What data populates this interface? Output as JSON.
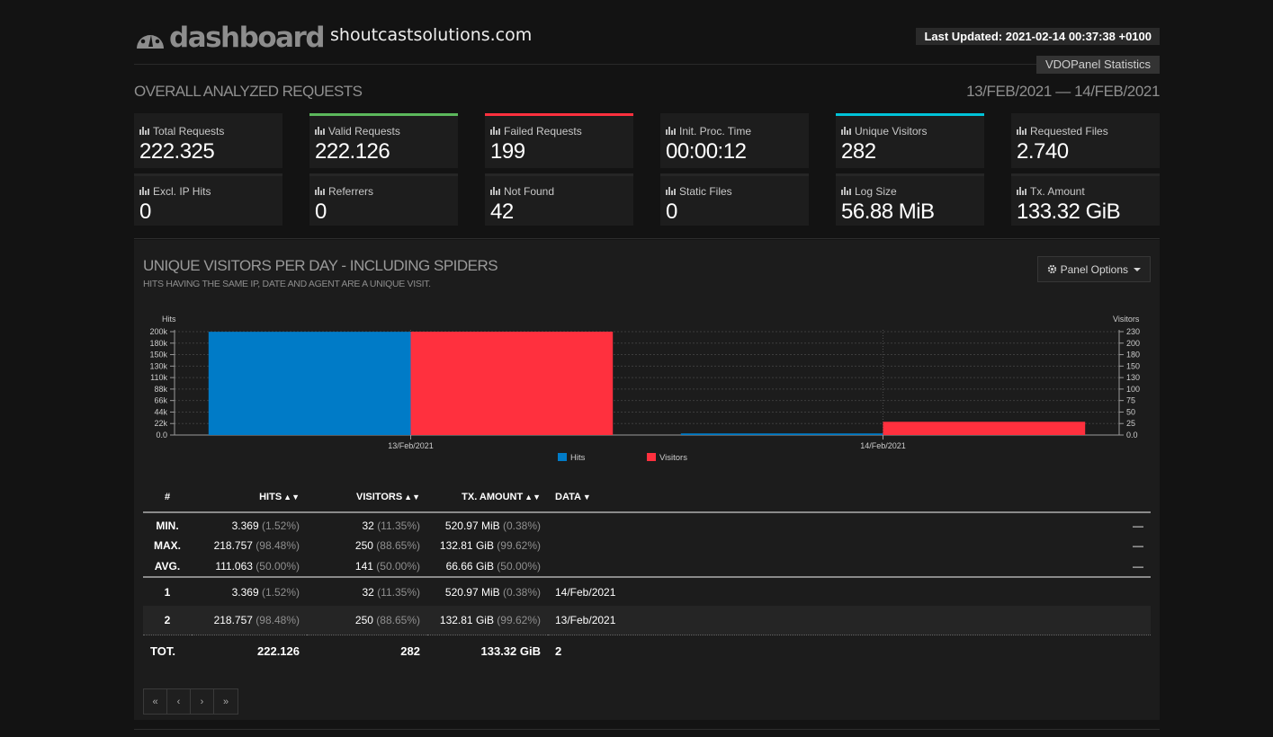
{
  "header": {
    "logo_text": "dashboard",
    "site_name": "shoutcastsolutions.com",
    "last_updated": "Last Updated: 2021-02-14 00:37:38 +0100",
    "tag": "VDOPanel Statistics"
  },
  "overall": {
    "title": "OVERALL ANALYZED REQUESTS",
    "dates": "13/FEB/2021 — 14/FEB/2021"
  },
  "stats": [
    {
      "label": "Total Requests",
      "value": "222.325",
      "accent": "#1d1d1d"
    },
    {
      "label": "Valid Requests",
      "value": "222.126",
      "accent": "#5cb85c"
    },
    {
      "label": "Failed Requests",
      "value": "199",
      "accent": "#ff303e"
    },
    {
      "label": "Init. Proc. Time",
      "value": "00:00:12",
      "accent": "#1d1d1d"
    },
    {
      "label": "Unique Visitors",
      "value": "282",
      "accent": "#00c3d9"
    },
    {
      "label": "Requested Files",
      "value": "2.740",
      "accent": "#1d1d1d"
    },
    {
      "label": "Excl. IP Hits",
      "value": "0"
    },
    {
      "label": "Referrers",
      "value": "0"
    },
    {
      "label": "Not Found",
      "value": "42"
    },
    {
      "label": "Static Files",
      "value": "0"
    },
    {
      "label": "Log Size",
      "value": "56.88 MiB"
    },
    {
      "label": "Tx. Amount",
      "value": "133.32 GiB"
    }
  ],
  "panel": {
    "title": "UNIQUE VISITORS PER DAY - INCLUDING SPIDERS",
    "subtitle": "HITS HAVING THE SAME IP, DATE AND AGENT ARE A UNIQUE VISIT.",
    "options_label": "Panel Options"
  },
  "chart_data": {
    "type": "bar",
    "categories": [
      "13/Feb/2021",
      "14/Feb/2021"
    ],
    "series": [
      {
        "name": "Hits",
        "values": [
          218757,
          3369
        ],
        "color": "#007bc7",
        "axis": "left"
      },
      {
        "name": "Visitors",
        "values": [
          250,
          32
        ],
        "color": "#ff303e",
        "axis": "right"
      }
    ],
    "ylabel_left": "Hits",
    "ylabel_right": "Visitors",
    "left_ticks": [
      "0.0",
      "22k",
      "44k",
      "66k",
      "88k",
      "110k",
      "130k",
      "150k",
      "180k",
      "200k"
    ],
    "right_ticks": [
      "0.0",
      "25",
      "50",
      "75",
      "100",
      "130",
      "150",
      "180",
      "200",
      "230"
    ],
    "ylim_left": [
      0,
      219000
    ],
    "ylim_right": [
      0,
      250
    ],
    "grid": true,
    "legend": "bottom-center"
  },
  "table": {
    "headers": {
      "num": "#",
      "hits": "HITS",
      "visitors": "VISITORS",
      "tx": "TX. AMOUNT",
      "data": "DATA"
    },
    "summary": [
      {
        "label": "MIN.",
        "hits": "3.369",
        "hits_pct": "(1.52%)",
        "visitors": "32",
        "visitors_pct": "(11.35%)",
        "tx": "520.97 MiB",
        "tx_pct": "(0.38%)",
        "data": "—"
      },
      {
        "label": "MAX.",
        "hits": "218.757",
        "hits_pct": "(98.48%)",
        "visitors": "250",
        "visitors_pct": "(88.65%)",
        "tx": "132.81 GiB",
        "tx_pct": "(99.62%)",
        "data": "—"
      },
      {
        "label": "AVG.",
        "hits": "111.063",
        "hits_pct": "(50.00%)",
        "visitors": "141",
        "visitors_pct": "(50.00%)",
        "tx": "66.66 GiB",
        "tx_pct": "(50.00%)",
        "data": "—"
      }
    ],
    "rows": [
      {
        "num": "1",
        "hits": "3.369",
        "hits_pct": "(1.52%)",
        "visitors": "32",
        "visitors_pct": "(11.35%)",
        "tx": "520.97 MiB",
        "tx_pct": "(0.38%)",
        "data": "14/Feb/2021"
      },
      {
        "num": "2",
        "hits": "218.757",
        "hits_pct": "(98.48%)",
        "visitors": "250",
        "visitors_pct": "(88.65%)",
        "tx": "132.81 GiB",
        "tx_pct": "(99.62%)",
        "data": "13/Feb/2021"
      }
    ],
    "total": {
      "label": "TOT.",
      "hits": "222.126",
      "visitors": "282",
      "tx": "133.32 GiB",
      "data": "2"
    }
  },
  "pager": {
    "first": "«",
    "prev": "‹",
    "next": "›",
    "last": "»"
  }
}
